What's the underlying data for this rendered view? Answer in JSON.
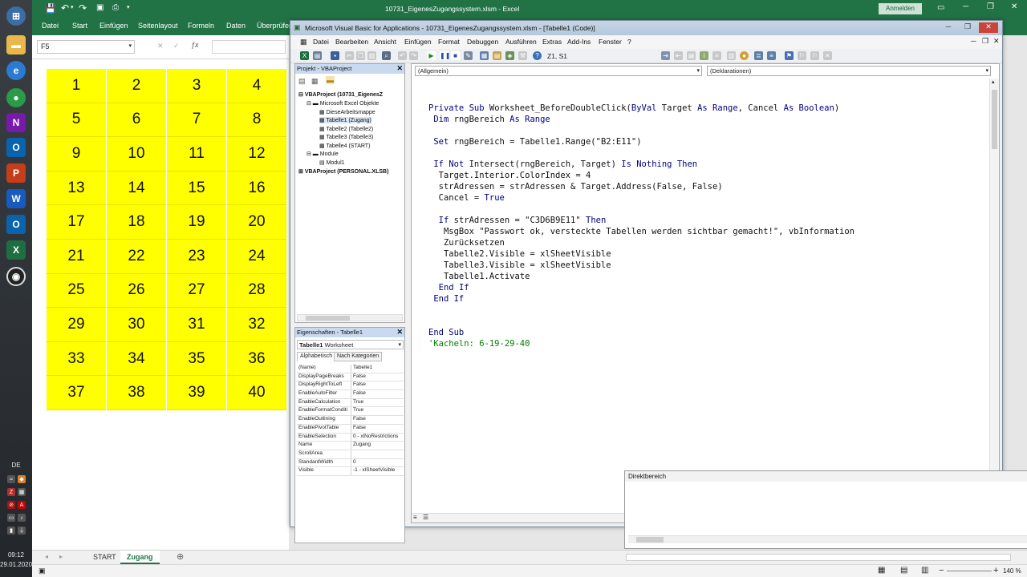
{
  "taskbar": {
    "language": "DE",
    "time": "09:12",
    "date": "29.01.2020"
  },
  "excel": {
    "title": "10731_EigenesZugangssystem.xlsm - Excel",
    "signin_label": "Anmelden",
    "ribbon_tabs": [
      "Datei",
      "Start",
      "Einfügen",
      "Seitenlayout",
      "Formeln",
      "Daten",
      "Überprüfen"
    ],
    "name_box": "F5",
    "formula_icon": "fx-icon",
    "cells": [
      1,
      2,
      3,
      4,
      5,
      6,
      7,
      8,
      9,
      10,
      11,
      12,
      13,
      14,
      15,
      16,
      17,
      18,
      19,
      20,
      21,
      22,
      23,
      24,
      25,
      26,
      27,
      28,
      29,
      30,
      31,
      32,
      33,
      34,
      35,
      36,
      37,
      38,
      39,
      40
    ],
    "sheet_tabs": [
      "START",
      "Zugang"
    ],
    "active_sheet": "Zugang",
    "zoom": "140 %",
    "cell_color": "#ffff00"
  },
  "vba": {
    "title": "Microsoft Visual Basic for Applications - 10731_EigenesZugangssystem.xlsm - [Tabelle1 (Code)]",
    "menu": [
      "Datei",
      "Bearbeiten",
      "Ansicht",
      "Einfügen",
      "Format",
      "Debuggen",
      "Ausführen",
      "Extras",
      "Add-Ins",
      "Fenster",
      "?"
    ],
    "cursor_position": "Z1, S1",
    "project_panel": {
      "title": "Projekt - VBAProject",
      "root": "VBAProject (10731_EigenesZ",
      "folder_objects": "Microsoft Excel Objekte",
      "items": [
        "DieseArbeitsmappe",
        "Tabelle1 (Zugang)",
        "Tabelle2 (Tabelle2)",
        "Tabelle3 (Tabelle3)",
        "Tabelle4 (START)"
      ],
      "folder_modules": "Module",
      "module": "Modul1",
      "personal": "VBAProject (PERSONAL.XLSB)"
    },
    "props_panel": {
      "title": "Eigenschaften - Tabelle1",
      "object_name": "Tabelle1",
      "object_type": "Worksheet",
      "tabs": [
        "Alphabetisch",
        "Nach Kategorien"
      ],
      "rows": [
        {
          "name": "(Name)",
          "value": "Tabelle1"
        },
        {
          "name": "DisplayPageBreaks",
          "value": "False"
        },
        {
          "name": "DisplayRightToLeft",
          "value": "False"
        },
        {
          "name": "EnableAutoFilter",
          "value": "False"
        },
        {
          "name": "EnableCalculation",
          "value": "True"
        },
        {
          "name": "EnableFormatConditi",
          "value": "True"
        },
        {
          "name": "EnableOutlining",
          "value": "False"
        },
        {
          "name": "EnablePivotTable",
          "value": "False"
        },
        {
          "name": "EnableSelection",
          "value": "0 - xlNoRestrictions"
        },
        {
          "name": "Name",
          "value": "Zugang"
        },
        {
          "name": "ScrollArea",
          "value": ""
        },
        {
          "name": "StandardWidth",
          "value": "0"
        },
        {
          "name": "Visible",
          "value": "-1 - xlSheetVisible"
        }
      ]
    },
    "code": {
      "object_combo": "(Allgemein)",
      "proc_combo": "(Deklarationen)",
      "lines": [
        "Private Sub Worksheet_BeforeDoubleClick(ByVal Target As Range, Cancel As Boolean)",
        " Dim rngBereich As Range",
        "",
        " Set rngBereich = Tabelle1.Range(\"B2:E11\")",
        "",
        " If Not Intersect(rngBereich, Target) Is Nothing Then",
        "  Target.Interior.ColorIndex = 4",
        "  strAdressen = strAdressen & Target.Address(False, False)",
        "  Cancel = True",
        "",
        "  If strAdressen = \"C3D6B9E11\" Then",
        "   MsgBox \"Passwort ok, versteckte Tabellen werden sichtbar gemacht!\", vbInformation",
        "   Zurücksetzen",
        "   Tabelle2.Visible = xlSheetVisible",
        "   Tabelle3.Visible = xlSheetVisible",
        "   Tabelle1.Activate",
        "  End If",
        " End If",
        "",
        "",
        "End Sub",
        "'Kacheln: 6-19-29-40"
      ]
    },
    "immediate_title": "Direktbereich"
  }
}
